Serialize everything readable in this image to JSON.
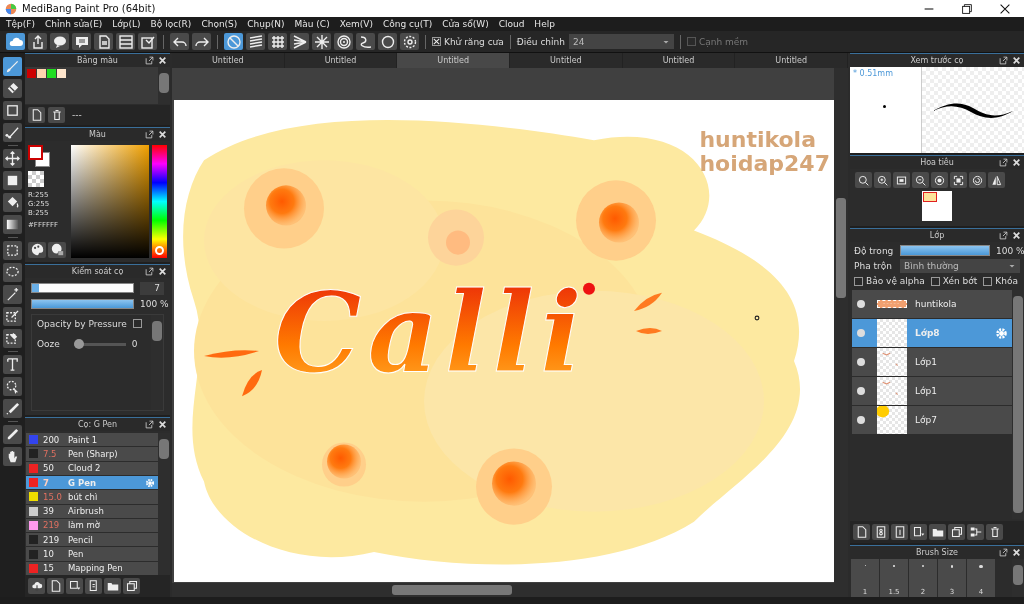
{
  "window": {
    "title": "MediBang Paint Pro (64bit)"
  },
  "menu": [
    "Tệp(F)",
    "Chỉnh sửa(E)",
    "Lớp(L)",
    "Bộ lọc(R)",
    "Chọn(S)",
    "Chụp(N)",
    "Màu (C)",
    "Xem(V)",
    "Công cụ(T)",
    "Cửa sổ(W)",
    "Cloud",
    "Help"
  ],
  "toolbar": {
    "snaps": [
      {
        "kind": "off",
        "selected": true
      },
      {
        "kind": "parallel",
        "selected": false
      },
      {
        "kind": "grid",
        "selected": false
      },
      {
        "kind": "fan",
        "selected": false
      },
      {
        "kind": "radial",
        "selected": false
      },
      {
        "kind": "concentric",
        "selected": false
      },
      {
        "kind": "curve",
        "selected": false
      },
      {
        "kind": "circle",
        "selected": false
      }
    ],
    "antialias": {
      "label": "Khử răng cưa",
      "checked": true
    },
    "adjust": {
      "label": "Điều chỉnh",
      "value": "24"
    },
    "soft_edge": {
      "label": "Cạnh mềm",
      "checked": false
    }
  },
  "tools": [
    {
      "kind": "brush",
      "selected": true
    },
    {
      "kind": "eraser",
      "selected": false
    },
    {
      "kind": "rect",
      "selected": false
    },
    {
      "kind": "dots",
      "selected": false
    },
    {
      "kind": "move",
      "selected": false
    },
    {
      "kind": "fill",
      "selected": false
    },
    {
      "kind": "bucket",
      "selected": false
    },
    {
      "kind": "gradient",
      "selected": false
    },
    {
      "kind": "select",
      "selected": false
    },
    {
      "kind": "lasso",
      "selected": false
    },
    {
      "kind": "wand",
      "selected": false
    },
    {
      "kind": "selpen",
      "selected": false
    },
    {
      "kind": "selerase",
      "selected": false
    },
    {
      "kind": "text",
      "selected": false
    },
    {
      "kind": "pointer",
      "selected": false
    },
    {
      "kind": "knife",
      "selected": false
    },
    {
      "kind": "dropper",
      "selected": false
    },
    {
      "kind": "hand",
      "selected": false
    }
  ],
  "tabs": [
    {
      "label": "Untitled",
      "selected": false
    },
    {
      "label": "Untitled",
      "selected": false
    },
    {
      "label": "Untitled",
      "selected": true
    },
    {
      "label": "Untitled",
      "selected": false
    },
    {
      "label": "Untitled",
      "selected": false
    },
    {
      "label": "Untitled",
      "selected": false
    }
  ],
  "palette": {
    "title": "Bảng màu",
    "swatches": [
      {
        "color": "#cc0000"
      },
      {
        "color": "#ffd5b0"
      },
      {
        "color": "#22dd22"
      },
      {
        "color": "#ffe6cc"
      }
    ],
    "name": "---"
  },
  "color": {
    "title": "Màu",
    "rgb": [
      "R:255",
      "G:255",
      "B:255"
    ],
    "hex": "#FFFFFF",
    "hue": {
      "level": 0
    }
  },
  "brush_control": {
    "title": "Kiểm soát cọ",
    "size_slider": {
      "level": 0.07
    },
    "size": "7",
    "opacity_slider": {
      "level": 1
    },
    "opacity": "100 %",
    "pressure": {
      "label": "Opacity by Pressure",
      "checked": false
    },
    "ooze": {
      "label": "Ooze",
      "level": 0,
      "value": "0"
    }
  },
  "brushes": {
    "title": "Cọ: G Pen",
    "items": [
      {
        "color": "#3344ee",
        "size": "200",
        "name": "Paint 1",
        "size_tinted": false,
        "selected": false
      },
      {
        "color": "#222222",
        "size": "7.5",
        "name": "Pen (Sharp)",
        "size_tinted": true,
        "selected": false
      },
      {
        "color": "#ee2222",
        "size": "50",
        "name": "Cloud 2",
        "size_tinted": false,
        "selected": false
      },
      {
        "color": "#ee2222",
        "size": "7",
        "name": "G Pen",
        "size_tinted": true,
        "selected": true
      },
      {
        "color": "#eedd00",
        "size": "15.0",
        "name": "bút chì",
        "size_tinted": true,
        "selected": false
      },
      {
        "color": "#cccccc",
        "size": "39",
        "name": "Airbrush",
        "size_tinted": false,
        "selected": false
      },
      {
        "color": "#ff99ee",
        "size": "219",
        "name": "làm mờ",
        "size_tinted": true,
        "selected": false
      },
      {
        "color": "#222222",
        "size": "219",
        "name": "Pencil",
        "size_tinted": false,
        "selected": false
      },
      {
        "color": "#222222",
        "size": "10",
        "name": "Pen",
        "size_tinted": false,
        "selected": false
      },
      {
        "color": "#ee2222",
        "size": "15",
        "name": "Mapping Pen",
        "size_tinted": false,
        "selected": false
      }
    ]
  },
  "canvas": {
    "lettering": "Calli",
    "watermark_lines": [
      "huntikola",
      "hoidap247"
    ]
  },
  "preview": {
    "title": "Xem trước cọ",
    "size": "* 0.51mm"
  },
  "navigator": {
    "title": "Hoa tiêu"
  },
  "layers": {
    "title": "Lớp",
    "opacity_label": "Độ trong",
    "opacity_slider": {
      "level": 1
    },
    "opacity": "100 %",
    "blend_label": "Pha trộn",
    "blend": "Bình thường",
    "options": [
      {
        "label": "Bảo vệ alpha",
        "checked": false
      },
      {
        "label": "Xén bớt",
        "checked": false
      },
      {
        "label": "Khóa",
        "checked": false
      }
    ],
    "items": [
      {
        "name": "huntikola",
        "kind": "text",
        "visible": true,
        "selected": false
      },
      {
        "name": "Lớp8",
        "kind": "empty",
        "visible": true,
        "selected": true
      },
      {
        "name": "Lớp1",
        "kind": "sketch",
        "visible": true,
        "selected": false
      },
      {
        "name": "Lớp1",
        "kind": "sketch",
        "visible": true,
        "selected": false
      },
      {
        "name": "Lớp7",
        "kind": "yellow",
        "visible": true,
        "selected": false
      }
    ]
  },
  "brush_size": {
    "title": "Brush Size",
    "sizes": [
      "1",
      "1.5",
      "2",
      "3",
      "4"
    ]
  }
}
